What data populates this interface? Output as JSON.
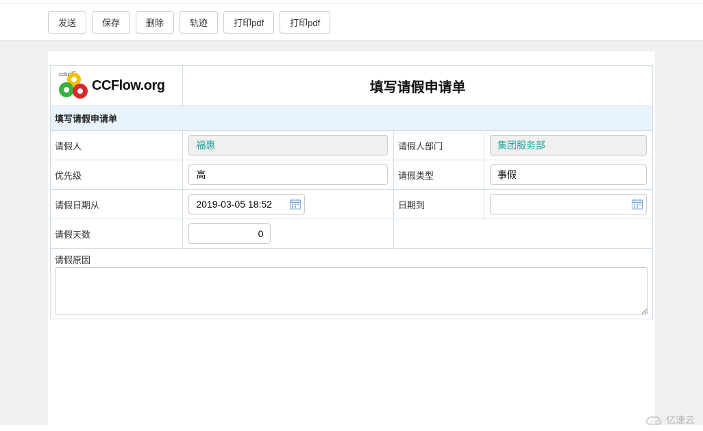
{
  "toolbar": {
    "send": "发送",
    "save": "保存",
    "delete": "删除",
    "track": "轨迹",
    "print_pdf_1": "打印pdf",
    "print_pdf_2": "打印pdf"
  },
  "logo": {
    "small_text": "ccbp版",
    "text": "CCFlow.org"
  },
  "form": {
    "title": "填写请假申请单",
    "section": "填写请假申请单",
    "labels": {
      "applicant": "请假人",
      "department": "请假人部门",
      "priority": "优先级",
      "leave_type": "请假类型",
      "date_from": "请假日期从",
      "date_to": "日期到",
      "days": "请假天数",
      "reason": "请假原因"
    },
    "values": {
      "applicant": "福惠",
      "department": "集团服务部",
      "priority": "高",
      "leave_type": "事假",
      "date_from": "2019-03-05 18:52",
      "date_to": "",
      "days": "0",
      "reason": ""
    }
  },
  "watermark": "亿速云"
}
